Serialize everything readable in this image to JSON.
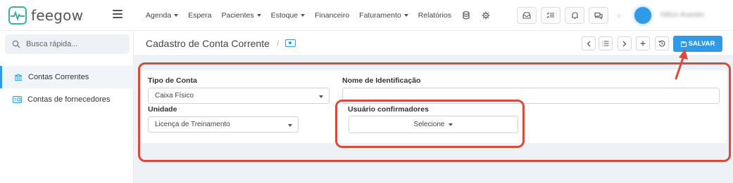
{
  "brand": {
    "name": "feegow"
  },
  "nav": [
    {
      "label": "Agenda",
      "dropdown": true
    },
    {
      "label": "Espera",
      "dropdown": false
    },
    {
      "label": "Pacientes",
      "dropdown": true
    },
    {
      "label": "Estoque",
      "dropdown": true
    },
    {
      "label": "Financeiro",
      "dropdown": false
    },
    {
      "label": "Faturamento",
      "dropdown": true
    },
    {
      "label": "Relatórios",
      "dropdown": false
    }
  ],
  "user": {
    "name": "Nilton Avarato"
  },
  "sidebar": {
    "search_placeholder": "Busca rápida...",
    "items": [
      {
        "label": "Contas Correntes",
        "active": true
      },
      {
        "label": "Contas de fornecedores",
        "active": false
      }
    ]
  },
  "page": {
    "title": "Cadastro de Conta Corrente",
    "breadcrumb_sep": "/",
    "save_label": "SALVAR"
  },
  "form": {
    "tipo_conta": {
      "label": "Tipo de Conta",
      "value": "Caixa Físico"
    },
    "nome_identificacao": {
      "label": "Nome de Identificação",
      "value": ""
    },
    "unidade": {
      "label": "Unidade",
      "value": "Licença de Treinamento"
    },
    "usuarios": {
      "label": "Usuário confirmadores",
      "value": "Selecione"
    }
  },
  "colors": {
    "accent": "#2f9be8",
    "annotation": "#d94a3a",
    "brand": "#3bb0a4"
  }
}
